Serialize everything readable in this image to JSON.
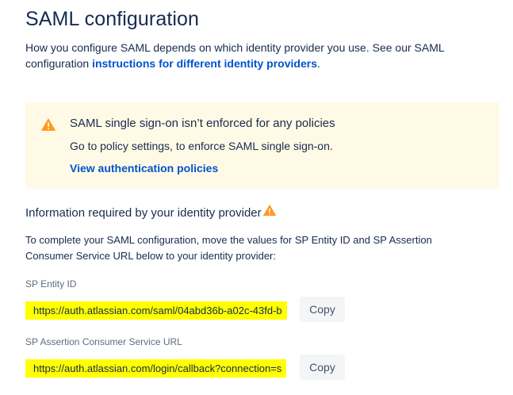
{
  "page": {
    "title": "SAML configuration",
    "intro_text": "How you configure SAML depends on which identity provider you use. See our SAML configuration ",
    "intro_link": "instructions for different identity providers",
    "intro_suffix": "."
  },
  "banner": {
    "icon": "warning-icon",
    "title": "SAML single sign-on isn’t enforced for any policies",
    "description": "Go to policy settings, to enforce SAML single sign-on.",
    "link": "View authentication policies",
    "background": "#FFFAE6",
    "icon_color": "#FF991F"
  },
  "idp_section": {
    "heading": "Information required by your identity provider",
    "heading_icon": "warning-icon",
    "description": "To complete your SAML configuration, move the values for SP Entity ID and SP Assertion Consumer Service URL below to your identity provider:",
    "fields": [
      {
        "label": "SP Entity ID",
        "value": "https://auth.atlassian.com/saml/04abd36b-a02c-43fd-b",
        "button": "Copy"
      },
      {
        "label": "SP Assertion Consumer Service URL",
        "value": "https://auth.atlassian.com/login/callback?connection=s",
        "button": "Copy"
      }
    ]
  },
  "colors": {
    "text": "#172B4D",
    "link": "#0052CC",
    "subtle": "#5E6C84",
    "highlight": "#FFFF00",
    "button_bg": "#F4F5F7"
  }
}
